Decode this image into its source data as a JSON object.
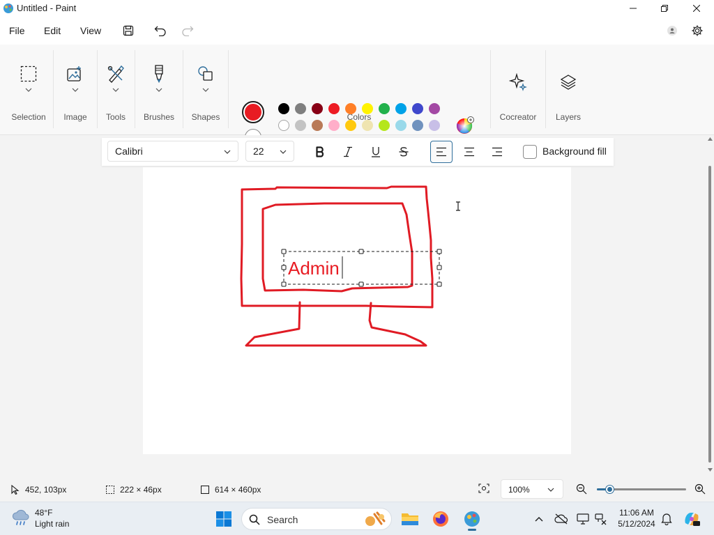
{
  "window": {
    "title": "Untitled - Paint"
  },
  "menu": {
    "file": "File",
    "edit": "Edit",
    "view": "View"
  },
  "ribbon": {
    "groups": {
      "selection": "Selection",
      "image": "Image",
      "tools": "Tools",
      "brushes": "Brushes",
      "shapes": "Shapes",
      "colors": "Colors",
      "cocreator": "Cocreator",
      "layers": "Layers"
    },
    "primary_color": "#e81c23",
    "secondary_color": "#ffffff",
    "palette_row1": [
      "#000000",
      "#7f7f7f",
      "#880015",
      "#ed1c24",
      "#ff7f27",
      "#fff200",
      "#22b14c",
      "#00a2e8",
      "#3f48cc",
      "#a349a4"
    ],
    "palette_row2": [
      "#ffffff",
      "#c3c3c3",
      "#b97a57",
      "#ffaec9",
      "#ffc90e",
      "#efe4b0",
      "#b5e61d",
      "#99d9ea",
      "#7092be",
      "#c8bfe7"
    ],
    "palette_row3_count": 10
  },
  "text_toolbar": {
    "font": "Calibri",
    "size": "22",
    "background_fill": "Background fill"
  },
  "canvas": {
    "text_content": "Admin",
    "text_color": "#e81c23",
    "stroke_color": "#e01b24"
  },
  "status": {
    "cursor_pos": "452, 103px",
    "selection_size": "222 × 46px",
    "canvas_size": "614 × 460px",
    "zoom": "100%",
    "zoom_fraction": 0.15
  },
  "taskbar": {
    "temperature": "48°F",
    "condition": "Light rain",
    "search_placeholder": "Search",
    "time": "11:06 AM",
    "date": "5/12/2024"
  }
}
